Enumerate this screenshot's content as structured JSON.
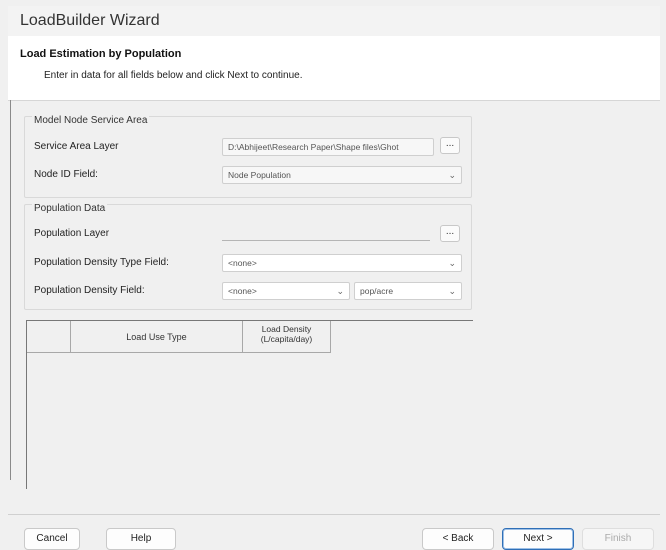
{
  "window": {
    "title": "LoadBuilder Wizard"
  },
  "header": {
    "step_title": "Load Estimation by Population",
    "description": "Enter in data for all fields below and click Next to continue."
  },
  "service_group": {
    "legend": "Model Node Service Area",
    "service_area_layer_label": "Service Area Layer",
    "service_area_layer_value": "D:\\Abhijeet\\Research Paper\\Shape files\\Ghot",
    "browse_label": "...",
    "node_id_field_label": "Node ID Field:",
    "node_id_field_value": "Node Population"
  },
  "population_group": {
    "legend": "Population Data",
    "population_layer_label": "Population Layer",
    "population_layer_value": "",
    "browse_label": "...",
    "density_type_label": "Population Density Type Field:",
    "density_type_value": "<none>",
    "density_field_label": "Population Density Field:",
    "density_field_value": "<none>",
    "density_unit_value": "pop/acre"
  },
  "grid": {
    "columns": [
      "",
      "Load Use Type",
      "Load Density",
      "(L/capita/day)"
    ]
  },
  "footer": {
    "cancel": "Cancel",
    "help": "Help",
    "back": "< Back",
    "next": "Next >",
    "finish": "Finish"
  },
  "icons": {
    "dropdown": "chevron-down-icon",
    "browse": "ellipsis-icon"
  }
}
